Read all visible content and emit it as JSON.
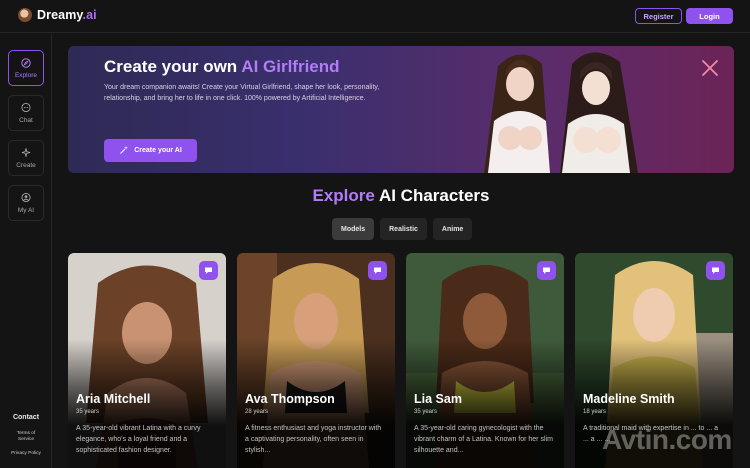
{
  "brand": {
    "name_main": "Dreamy",
    "name_suffix": ".ai"
  },
  "header": {
    "register_label": "Register",
    "login_label": "Login"
  },
  "sidebar": {
    "items": [
      {
        "label": "Explore",
        "icon": "compass-icon",
        "active": true
      },
      {
        "label": "Chat",
        "icon": "chat-bubble-icon",
        "active": false
      },
      {
        "label": "Create",
        "icon": "sparkle-icon",
        "active": false
      },
      {
        "label": "My AI",
        "icon": "avatar-icon",
        "active": false
      }
    ],
    "contact_label": "Contact",
    "terms_label_line1": "Terms of",
    "terms_label_line2": "Service",
    "privacy_label": "Privacy Policy"
  },
  "hero": {
    "title_prefix": "Create your own",
    "title_highlight": "AI Girlfriend",
    "description": "Your dream companion awaits! Create your Virtual Girlfriend, shape her look, personality, relationship, and bring her to life in one click. 100% powered by Artificial Intelligence.",
    "cta_label": "Create your AI"
  },
  "explore": {
    "title_highlight": "Explore",
    "title_rest": "AI Characters",
    "tabs": [
      {
        "label": "Models",
        "active": true
      },
      {
        "label": "Realistic",
        "active": false
      },
      {
        "label": "Anime",
        "active": false
      }
    ]
  },
  "characters": [
    {
      "name": "Aria Mitchell",
      "age": "35 years",
      "description": "A 35-year-old vibrant Latina with a curvy elegance, who's a loyal friend and a sophisticated fashion designer."
    },
    {
      "name": "Ava Thompson",
      "age": "28 years",
      "description": "A fitness enthusiast and yoga instructor with a captivating personality, often seen in stylish..."
    },
    {
      "name": "Lia Sam",
      "age": "35 years",
      "description": "A 35-year-old caring gynecologist with the vibrant charm of a Latina. Known for her slim silhouette and..."
    },
    {
      "name": "Madeline Smith",
      "age": "18 years",
      "description": "A traditional maid with expertise in ... to ... a ... a ... ..."
    }
  ],
  "watermark": "Avtin.com",
  "colors": {
    "accent": "#8f52ef",
    "accent_text": "#b27cf7",
    "background": "#141414"
  }
}
